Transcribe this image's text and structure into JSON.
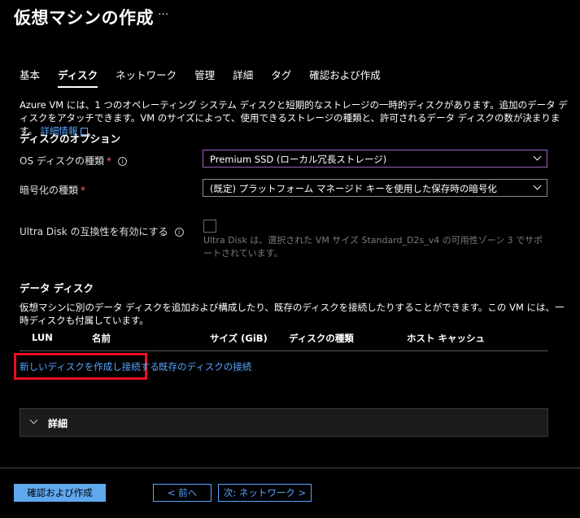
{
  "header": {
    "title": "仮想マシンの作成",
    "more": "···"
  },
  "tabs": [
    {
      "label": "基本",
      "active": false
    },
    {
      "label": "ディスク",
      "active": true
    },
    {
      "label": "ネットワーク",
      "active": false
    },
    {
      "label": "管理",
      "active": false
    },
    {
      "label": "詳細",
      "active": false
    },
    {
      "label": "タグ",
      "active": false
    },
    {
      "label": "確認および作成",
      "active": false
    }
  ],
  "intro": {
    "text": "Azure VM には、1 つのオペレーティング システム ディスクと短期的なストレージの一時的ディスクがあります。追加のデータ ディスクをアタッチできます。VM のサイズによって、使用できるストレージの種類と、許可されるデータ ディスクの数が決まります。",
    "link": "詳細情報"
  },
  "disk_options": {
    "title": "ディスクのオプション",
    "os_disk_type": {
      "label": "OS ディスクの種類",
      "required": "*",
      "info": "i",
      "value": "Premium SSD (ローカル冗長ストレージ)"
    },
    "encryption_type": {
      "label": "暗号化の種類",
      "required": "*",
      "value": "(既定) プラットフォーム マネージド キーを使用した保存時の暗号化"
    },
    "ultra_disk": {
      "label": "Ultra Disk の互換性を有効にする",
      "info": "i",
      "checked": false,
      "note": "Ultra Disk は、選択された VM サイズ Standard_D2s_v4 の可用性ゾーン 3 でサポートされています。"
    }
  },
  "data_disks": {
    "title": "データ ディスク",
    "description": "仮想マシンに別のデータ ディスクを追加および構成したり、既存のディスクを接続したりすることができます。この VM には、一時ディスクも付属しています。",
    "columns": [
      "LUN",
      "名前",
      "サイズ (GiB)",
      "ディスクの種類",
      "ホスト キャッシュ"
    ],
    "create_attach_link": "新しいディスクを作成し接続する",
    "attach_existing_link": "既存のディスクの接続"
  },
  "details": {
    "label": "詳細"
  },
  "footer": {
    "review_create": "確認および作成",
    "previous": "< 前へ",
    "next": "次: ネットワーク >"
  },
  "colors": {
    "accent": "#58a6ff",
    "primary_button": "#5fa8ee",
    "highlight": "#e81123",
    "focus": "#a05cc4"
  }
}
